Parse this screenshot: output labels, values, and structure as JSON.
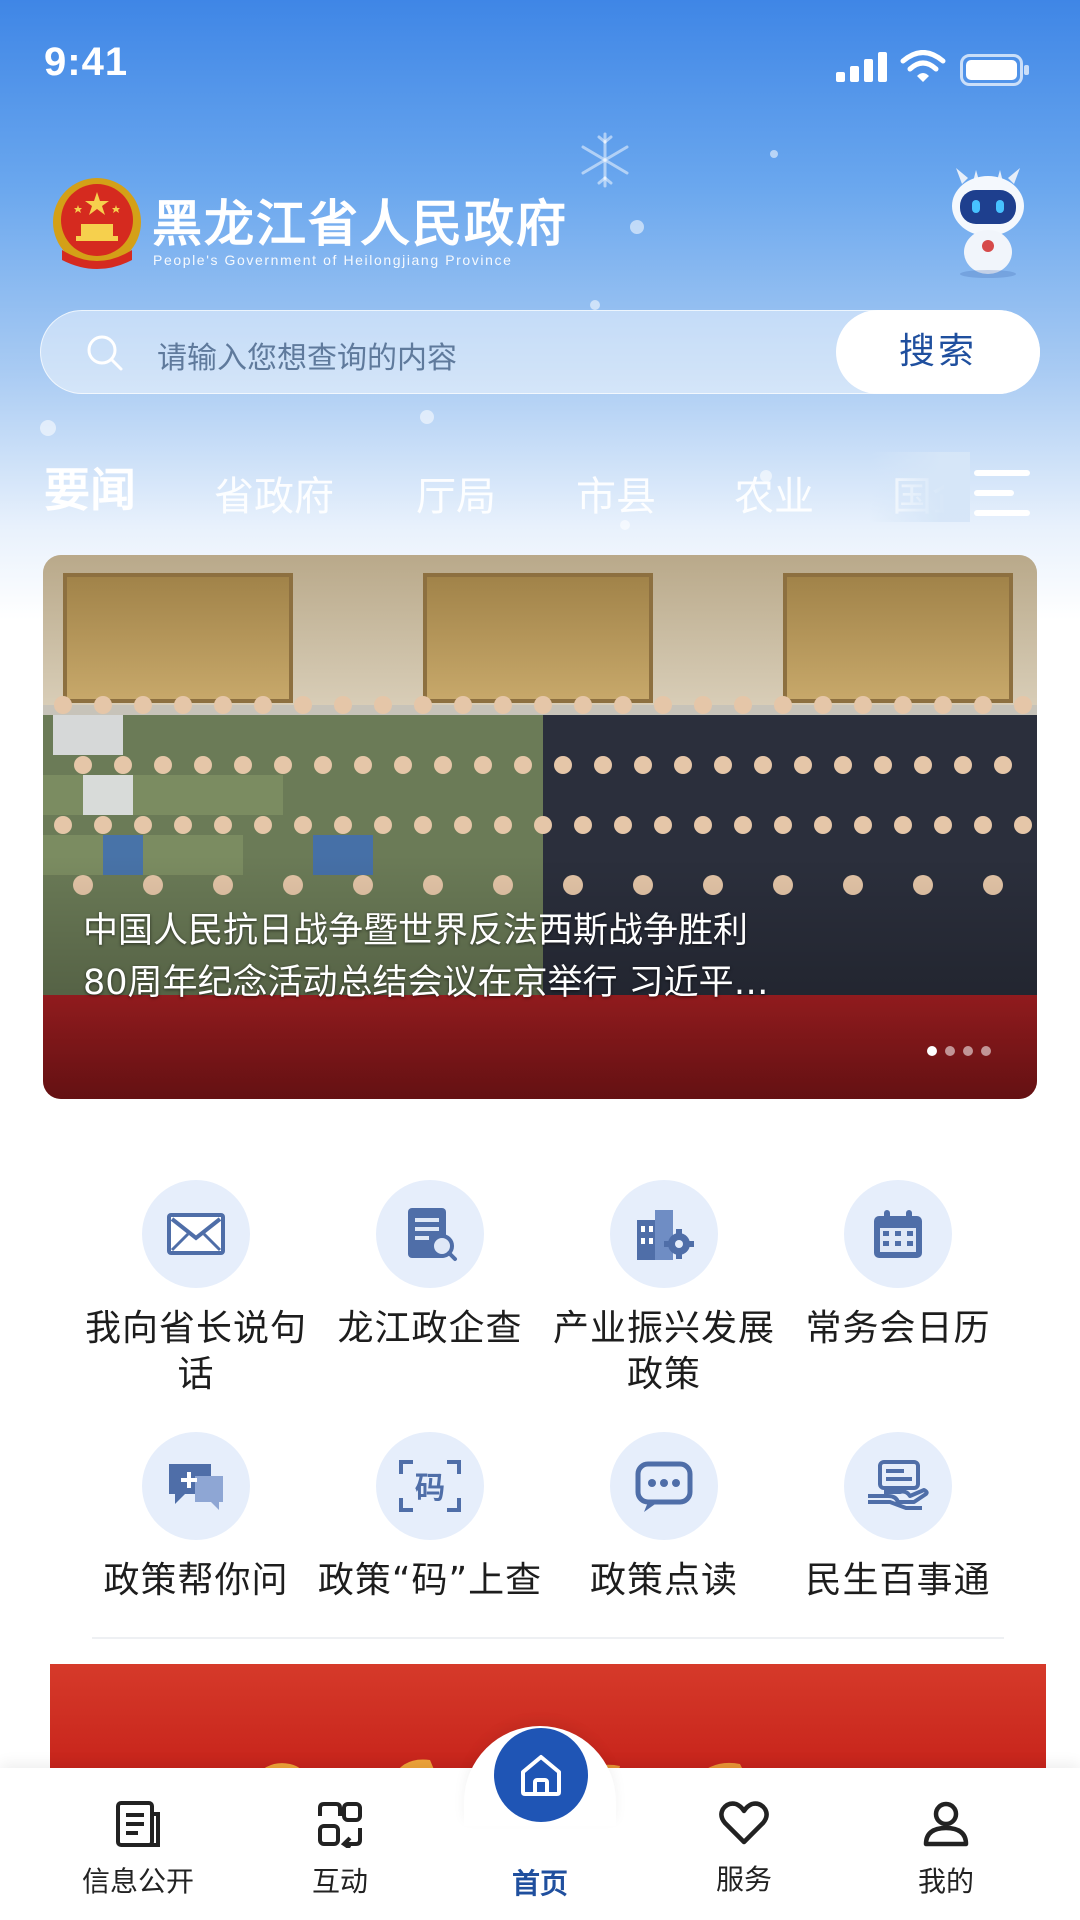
{
  "status_bar": {
    "time": "9:41"
  },
  "header": {
    "title": "黑龙江省人民政府",
    "subtitle": "People's Government of Heilongjiang Province"
  },
  "search": {
    "placeholder": "请输入您想查询的内容",
    "button_label": "搜索"
  },
  "tabs": [
    {
      "label": "要闻",
      "active": true
    },
    {
      "label": "省政府",
      "active": false
    },
    {
      "label": "厅局",
      "active": false
    },
    {
      "label": "市县",
      "active": false
    },
    {
      "label": "农业",
      "active": false
    },
    {
      "label": "国企",
      "active": false
    }
  ],
  "banner": {
    "caption_line1": "中国人民抗日战争暨世界反法西斯战争胜利",
    "caption_line2": "80周年纪念活动总结会议在京举行 习近平…",
    "slide_count": 4,
    "active_slide": 1
  },
  "features": [
    {
      "label": "我向省长说句话",
      "icon": "envelope-icon"
    },
    {
      "label": "龙江政企查",
      "icon": "document-search-icon"
    },
    {
      "label": "产业振兴发展政策",
      "icon": "industry-gear-icon"
    },
    {
      "label": "常务会日历",
      "icon": "calendar-icon"
    },
    {
      "label": "政策帮你问",
      "icon": "chat-plus-icon"
    },
    {
      "label": "政策“码”上查",
      "icon": "code-scan-icon"
    },
    {
      "label": "政策点读",
      "icon": "chat-bubble-icon"
    },
    {
      "label": "民生百事通",
      "icon": "hand-service-icon"
    }
  ],
  "bottom_nav": [
    {
      "label": "信息公开",
      "icon": "document-icon"
    },
    {
      "label": "互动",
      "icon": "interaction-icon"
    },
    {
      "label": "首页",
      "icon": "home-icon",
      "active": true
    },
    {
      "label": "服务",
      "icon": "heart-icon"
    },
    {
      "label": "我的",
      "icon": "user-icon"
    }
  ],
  "colors": {
    "brand_blue": "#1f55b5",
    "accent_red": "#c52119"
  }
}
